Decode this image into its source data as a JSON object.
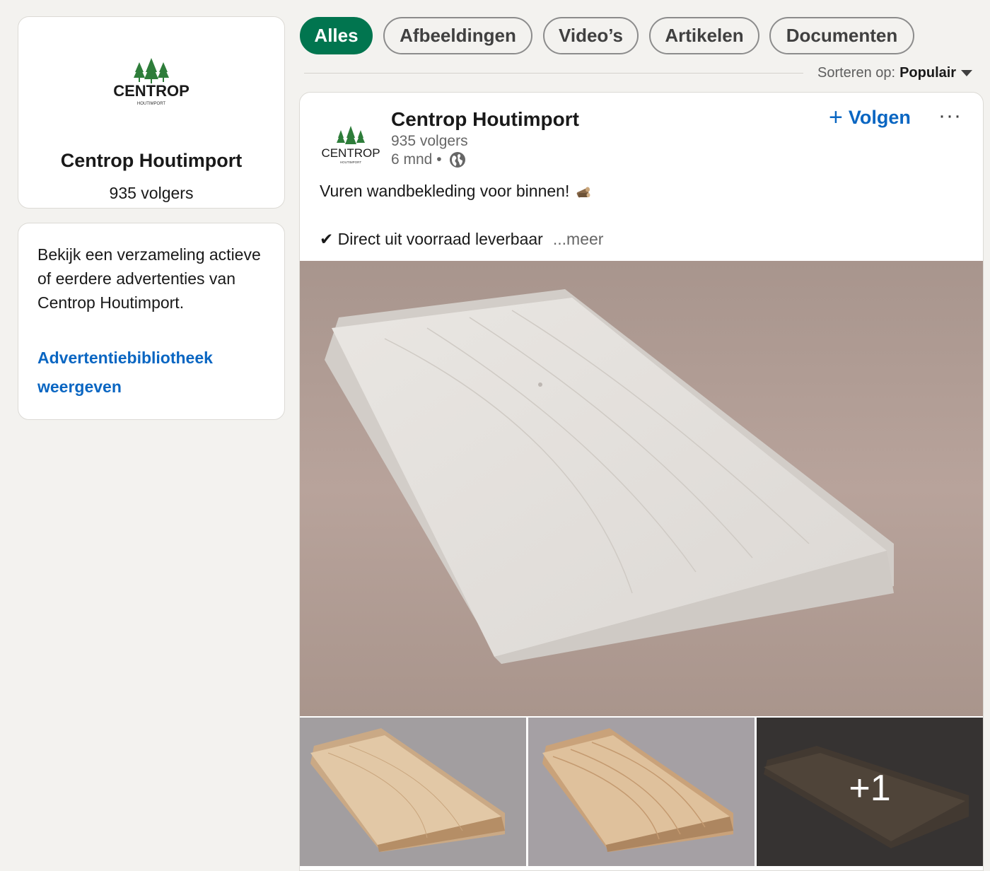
{
  "company": {
    "name": "Centrop Houtimport",
    "followers": "935 volgers",
    "logo_word": "CENTROP",
    "logo_sub": "HOUTIMPORT"
  },
  "ads": {
    "description": "Bekijk een verzameling actieve of eerdere advertenties van Centrop Houtimport.",
    "link_label": "Advertentiebibliotheek weergeven"
  },
  "filters": [
    "Alles",
    "Afbeeldingen",
    "Video’s",
    "Artikelen",
    "Documenten"
  ],
  "sort": {
    "label": "Sorteren op:",
    "value": "Populair"
  },
  "post": {
    "author": "Centrop Houtimport",
    "followers": "935 volgers",
    "time": "6 mnd •",
    "follow_label": "Volgen",
    "more_label": "···",
    "line1": "Vuren wandbekleding voor binnen!",
    "line2": "✔ Direct uit voorraad leverbaar",
    "see_more": "...meer",
    "extra_images": "+1"
  },
  "colors": {
    "accent_green": "#01754f",
    "link_blue": "#0a66c2",
    "logo_green": "#2e7d3a"
  }
}
